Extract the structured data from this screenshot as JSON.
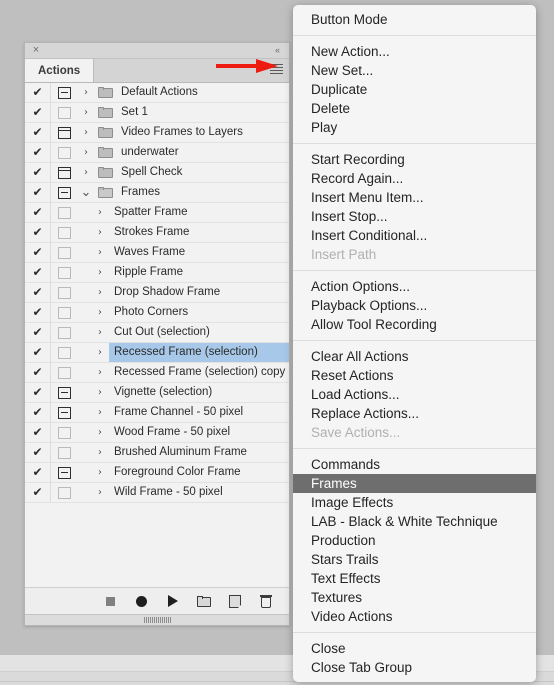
{
  "desktop": {
    "background_color": "#bfbfbf"
  },
  "panel": {
    "tab_label": "Actions",
    "close_icon_glyph": "×",
    "collapse_icon_glyph": "«",
    "menu_icon_name": "hamburger-menu-icon",
    "rows": [
      {
        "label": "Default Actions",
        "checked": true,
        "dialog": "on",
        "expanded": false,
        "folder": true,
        "child": false,
        "selected": false
      },
      {
        "label": "Set 1",
        "checked": true,
        "dialog": "off",
        "expanded": false,
        "folder": true,
        "child": false,
        "selected": false
      },
      {
        "label": "Video Frames to Layers",
        "checked": true,
        "dialog": "partial",
        "expanded": false,
        "folder": true,
        "child": false,
        "selected": false
      },
      {
        "label": "underwater",
        "checked": true,
        "dialog": "off",
        "expanded": false,
        "folder": true,
        "child": false,
        "selected": false
      },
      {
        "label": "Spell Check",
        "checked": true,
        "dialog": "partial",
        "expanded": false,
        "folder": true,
        "child": false,
        "selected": false
      },
      {
        "label": "Frames",
        "checked": true,
        "dialog": "on",
        "expanded": true,
        "folder": true,
        "child": false,
        "selected": false
      },
      {
        "label": "Spatter Frame",
        "checked": true,
        "dialog": "off",
        "expanded": false,
        "folder": false,
        "child": true,
        "selected": false
      },
      {
        "label": "Strokes Frame",
        "checked": true,
        "dialog": "off",
        "expanded": false,
        "folder": false,
        "child": true,
        "selected": false
      },
      {
        "label": "Waves Frame",
        "checked": true,
        "dialog": "off",
        "expanded": false,
        "folder": false,
        "child": true,
        "selected": false
      },
      {
        "label": "Ripple Frame",
        "checked": true,
        "dialog": "off",
        "expanded": false,
        "folder": false,
        "child": true,
        "selected": false
      },
      {
        "label": "Drop Shadow Frame",
        "checked": true,
        "dialog": "off",
        "expanded": false,
        "folder": false,
        "child": true,
        "selected": false
      },
      {
        "label": "Photo Corners",
        "checked": true,
        "dialog": "off",
        "expanded": false,
        "folder": false,
        "child": true,
        "selected": false
      },
      {
        "label": "Cut Out (selection)",
        "checked": true,
        "dialog": "off",
        "expanded": false,
        "folder": false,
        "child": true,
        "selected": false
      },
      {
        "label": "Recessed Frame (selection)",
        "checked": true,
        "dialog": "off",
        "expanded": false,
        "folder": false,
        "child": true,
        "selected": true
      },
      {
        "label": "Recessed Frame (selection) copy",
        "checked": true,
        "dialog": "off",
        "expanded": false,
        "folder": false,
        "child": true,
        "selected": false
      },
      {
        "label": "Vignette (selection)",
        "checked": true,
        "dialog": "on",
        "expanded": false,
        "folder": false,
        "child": true,
        "selected": false
      },
      {
        "label": "Frame Channel - 50 pixel",
        "checked": true,
        "dialog": "on",
        "expanded": false,
        "folder": false,
        "child": true,
        "selected": false
      },
      {
        "label": "Wood Frame - 50 pixel",
        "checked": true,
        "dialog": "off",
        "expanded": false,
        "folder": false,
        "child": true,
        "selected": false
      },
      {
        "label": "Brushed Aluminum Frame",
        "checked": true,
        "dialog": "off",
        "expanded": false,
        "folder": false,
        "child": true,
        "selected": false
      },
      {
        "label": "Foreground Color Frame",
        "checked": true,
        "dialog": "on",
        "expanded": false,
        "folder": false,
        "child": true,
        "selected": false
      },
      {
        "label": "Wild Frame - 50 pixel",
        "checked": true,
        "dialog": "off",
        "expanded": false,
        "folder": false,
        "child": true,
        "selected": false
      }
    ],
    "check_glyph": "✔",
    "collapsed_arrow_glyph": "›",
    "expanded_arrow_glyph": "⌄",
    "toolbar": [
      {
        "name": "stop-button",
        "label": "Stop"
      },
      {
        "name": "record-button",
        "label": "Begin recording"
      },
      {
        "name": "play-button",
        "label": "Play selection"
      },
      {
        "name": "new-set-button",
        "label": "Create new set"
      },
      {
        "name": "new-action-button",
        "label": "Create new action"
      },
      {
        "name": "delete-button",
        "label": "Delete"
      }
    ]
  },
  "annotation": {
    "arrow_color": "#ee1b11",
    "arrow_name": "red-pointer-arrow"
  },
  "menu": {
    "groups": [
      {
        "items": [
          {
            "label": "Button Mode",
            "disabled": false,
            "selected": false
          }
        ]
      },
      {
        "items": [
          {
            "label": "New Action...",
            "disabled": false,
            "selected": false
          },
          {
            "label": "New Set...",
            "disabled": false,
            "selected": false
          },
          {
            "label": "Duplicate",
            "disabled": false,
            "selected": false
          },
          {
            "label": "Delete",
            "disabled": false,
            "selected": false
          },
          {
            "label": "Play",
            "disabled": false,
            "selected": false
          }
        ]
      },
      {
        "items": [
          {
            "label": "Start Recording",
            "disabled": false,
            "selected": false
          },
          {
            "label": "Record Again...",
            "disabled": false,
            "selected": false
          },
          {
            "label": "Insert Menu Item...",
            "disabled": false,
            "selected": false
          },
          {
            "label": "Insert Stop...",
            "disabled": false,
            "selected": false
          },
          {
            "label": "Insert Conditional...",
            "disabled": false,
            "selected": false
          },
          {
            "label": "Insert Path",
            "disabled": true,
            "selected": false
          }
        ]
      },
      {
        "items": [
          {
            "label": "Action Options...",
            "disabled": false,
            "selected": false
          },
          {
            "label": "Playback Options...",
            "disabled": false,
            "selected": false
          },
          {
            "label": "Allow Tool Recording",
            "disabled": false,
            "selected": false
          }
        ]
      },
      {
        "items": [
          {
            "label": "Clear All Actions",
            "disabled": false,
            "selected": false
          },
          {
            "label": "Reset Actions",
            "disabled": false,
            "selected": false
          },
          {
            "label": "Load Actions...",
            "disabled": false,
            "selected": false
          },
          {
            "label": "Replace Actions...",
            "disabled": false,
            "selected": false
          },
          {
            "label": "Save Actions...",
            "disabled": true,
            "selected": false
          }
        ]
      },
      {
        "items": [
          {
            "label": "Commands",
            "disabled": false,
            "selected": false
          },
          {
            "label": "Frames",
            "disabled": false,
            "selected": true
          },
          {
            "label": "Image Effects",
            "disabled": false,
            "selected": false
          },
          {
            "label": "LAB - Black & White Technique",
            "disabled": false,
            "selected": false
          },
          {
            "label": "Production",
            "disabled": false,
            "selected": false
          },
          {
            "label": "Stars Trails",
            "disabled": false,
            "selected": false
          },
          {
            "label": "Text Effects",
            "disabled": false,
            "selected": false
          },
          {
            "label": "Textures",
            "disabled": false,
            "selected": false
          },
          {
            "label": "Video Actions",
            "disabled": false,
            "selected": false
          }
        ]
      },
      {
        "items": [
          {
            "label": "Close",
            "disabled": false,
            "selected": false
          },
          {
            "label": "Close Tab Group",
            "disabled": false,
            "selected": false
          }
        ]
      }
    ]
  }
}
